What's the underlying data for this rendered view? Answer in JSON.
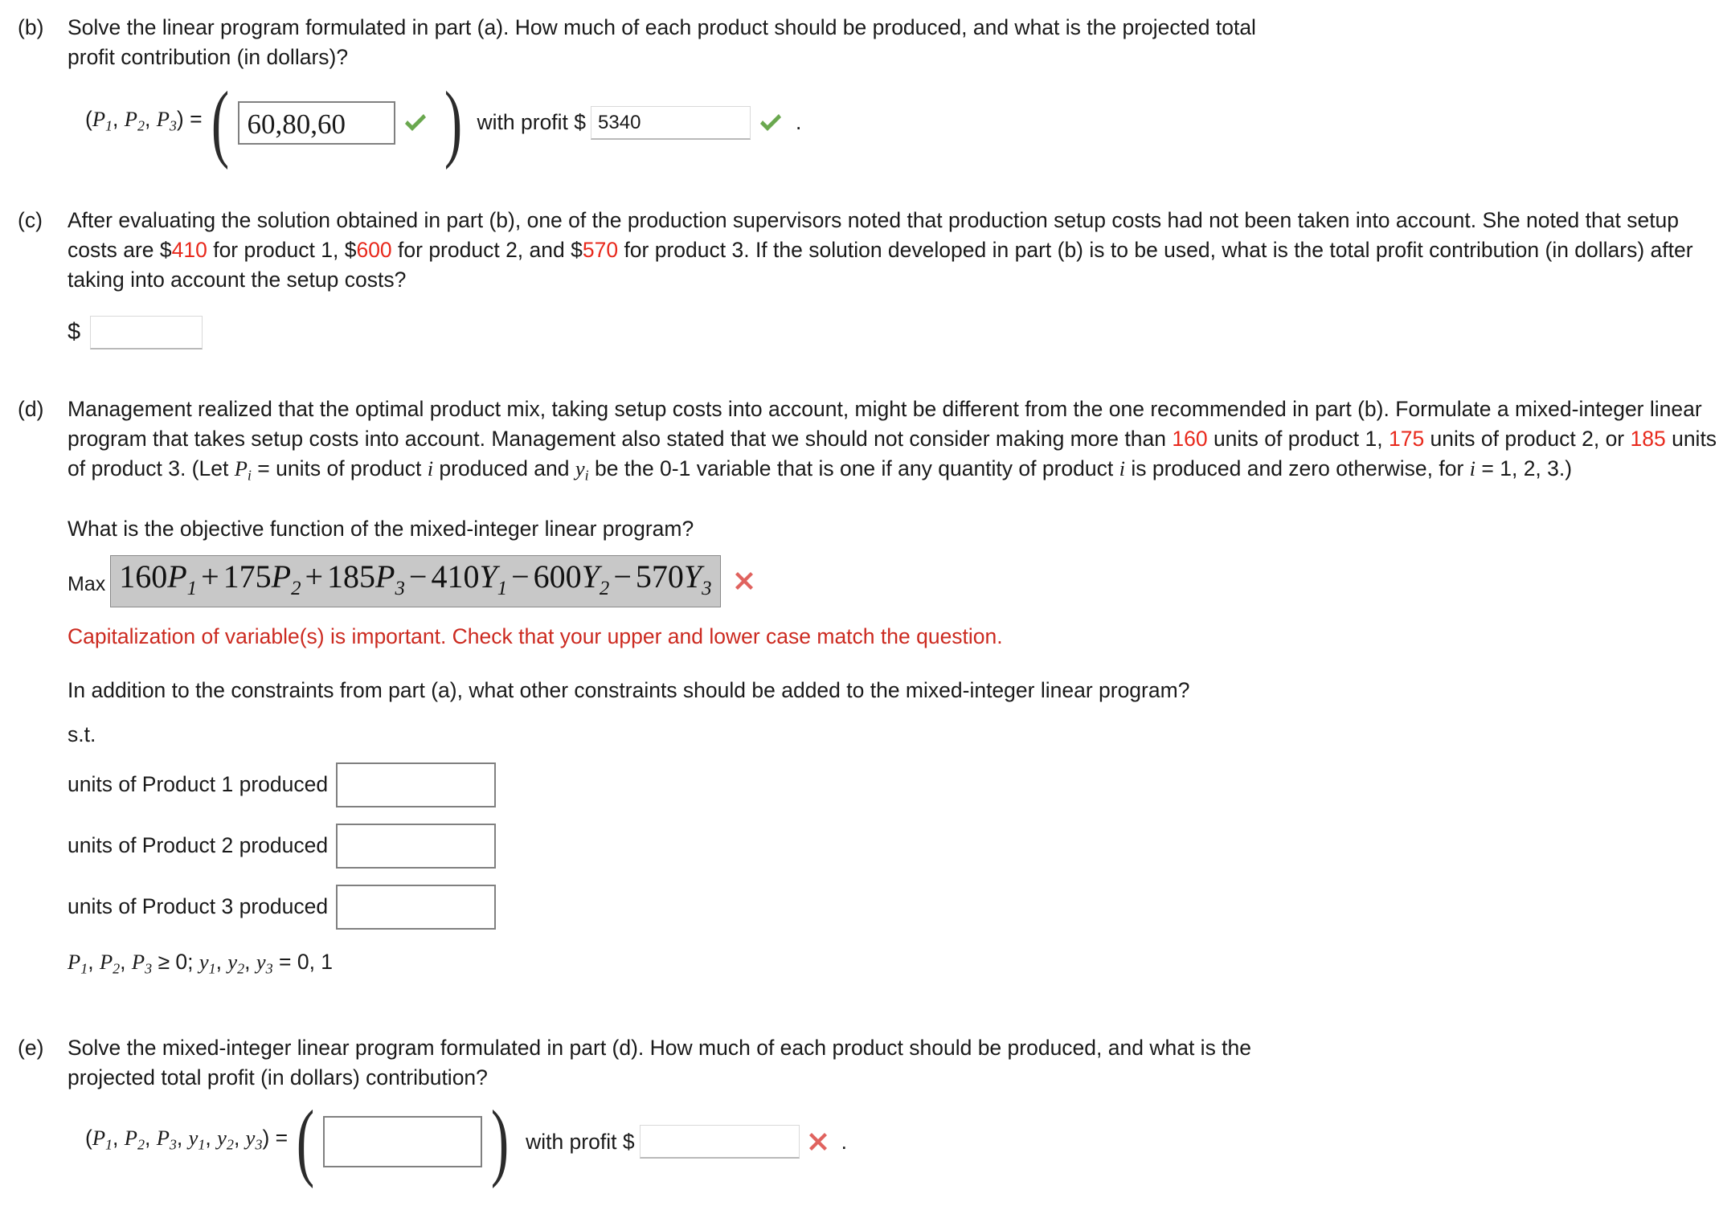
{
  "colors": {
    "highlight_red": "#e8291c",
    "error_red": "#cc2a20",
    "x_mark_red": "#e0635f",
    "check_green": "#6aa84f",
    "objective_box_bg": "#c8c8c8",
    "input_border": "#808080"
  },
  "parts": {
    "b": {
      "label": "(b)",
      "text": "Solve the linear program formulated in part (a). How much of each product should be produced, and what is the projected total profit contribution (in dollars)?",
      "tuple_prefix": "(P1, P2, P3) =",
      "tuple_vars": [
        "P",
        "P",
        "P"
      ],
      "tuple_subs": [
        "1",
        "2",
        "3"
      ],
      "answer_value": "60,80,60",
      "answer_status": "correct",
      "with_profit_label": "with profit $",
      "profit_value": "5340",
      "profit_status": "correct",
      "trailing_period": "."
    },
    "c": {
      "label": "(c)",
      "text_seg_1": "After evaluating the solution obtained in part (b), one of the production supervisors noted that production setup costs had not been taken into account. She noted that setup costs are $",
      "cost_1": "410",
      "text_seg_2": " for product 1, $",
      "cost_2": "600",
      "text_seg_3": " for product 2, and $",
      "cost_3": "570",
      "text_seg_4": " for product 3. If the solution developed in part (b) is to be used, what is the total profit contribution (in dollars) after taking into account the setup costs?",
      "dollar_sign": "$",
      "answer_value": ""
    },
    "d": {
      "label": "(d)",
      "text_seg_1": "Management realized that the optimal product mix, taking setup costs into account, might be different from the one recommended in part (b). Formulate a mixed-integer linear program that takes setup costs into account. Management also stated that we should not consider making more than ",
      "max_1": "160",
      "text_seg_2": " units of product 1, ",
      "max_2": "175",
      "text_seg_3": " units of product 2, or ",
      "max_3": "185",
      "text_seg_4": " units of product 3. (Let P",
      "text_seg_5": " = units of product i produced and y",
      "text_seg_6": " be the 0-1 variable that is one if any quantity of product i is produced and zero otherwise, for i = 1, 2, 3.)",
      "objective_question": "What is the objective function of the mixed-integer linear program?",
      "max_label": "Max",
      "objective": {
        "terms": [
          {
            "coef": "160",
            "var": "P",
            "sub": "1",
            "op": ""
          },
          {
            "coef": "175",
            "var": "P",
            "sub": "2",
            "op": "+"
          },
          {
            "coef": "185",
            "var": "P",
            "sub": "3",
            "op": "+"
          },
          {
            "coef": "410",
            "var": "Y",
            "sub": "1",
            "op": "−"
          },
          {
            "coef": "600",
            "var": "Y",
            "sub": "2",
            "op": "−"
          },
          {
            "coef": "570",
            "var": "Y",
            "sub": "3",
            "op": "−"
          }
        ],
        "status": "incorrect"
      },
      "error_message": "Capitalization of variable(s) is important. Check that your upper and lower case match the question.",
      "constraints_question": "In addition to the constraints from part (a), what other constraints should be added to the mixed-integer linear program?",
      "st_label": "s.t.",
      "constraints": [
        {
          "label": "units of Product 1 produced",
          "value": ""
        },
        {
          "label": "units of Product 2 produced",
          "value": ""
        },
        {
          "label": "units of Product 3 produced",
          "value": ""
        }
      ],
      "nonnegativity": "P1, P2, P3 ≥ 0; y1, y2, y3 = 0, 1"
    },
    "e": {
      "label": "(e)",
      "text": "Solve the mixed-integer linear program formulated in part (d). How much of each product should be produced, and what is the projected total profit (in dollars) contribution?",
      "tuple_prefix": "(P1, P2, P3, y1, y2, y3) =",
      "answer_value": "",
      "with_profit_label": "with profit $",
      "profit_value": "",
      "profit_status": "incorrect",
      "trailing_period": "."
    }
  }
}
